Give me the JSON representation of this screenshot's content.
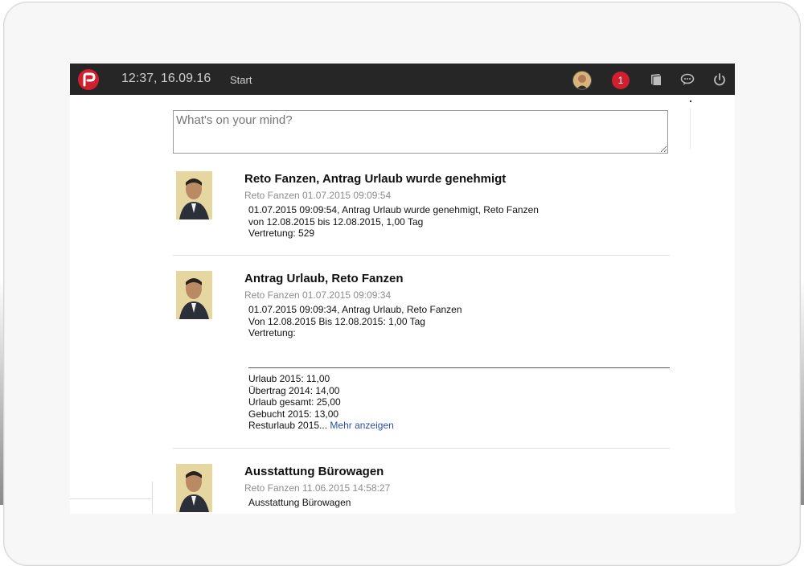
{
  "topbar": {
    "clock": "12:37, 16.09.16",
    "start_label": "Start",
    "notification_count": "1",
    "icons": [
      "logo-icon",
      "user-avatar",
      "notification-badge",
      "book-icon",
      "chat-icon",
      "power-icon"
    ],
    "colors": {
      "bar": "#262626",
      "accent": "#d01f2f"
    }
  },
  "composer": {
    "placeholder": "What's on your mind?"
  },
  "posts": [
    {
      "title": "Reto Fanzen, Antrag Urlaub wurde genehmigt",
      "meta": "Reto Fanzen 01.07.2015 09:09:54",
      "lines": [
        "01.07.2015 09:09:54, Antrag Urlaub wurde genehmigt, Reto Fanzen",
        "von 12.08.2015 bis 12.08.2015, 1,00 Tag",
        "Vertretung: 529"
      ]
    },
    {
      "title": "Antrag Urlaub, Reto Fanzen",
      "meta": "Reto Fanzen 01.07.2015 09:09:34",
      "lines": [
        "01.07.2015 09:09:34, Antrag Urlaub, Reto Fanzen",
        "Von 12.08.2015 Bis 12.08.2015: 1,00 Tag",
        "Vertretung:"
      ],
      "stats": [
        "Urlaub 2015: 11,00",
        "Übertrag 2014: 14,00",
        "Urlaub gesamt: 25,00",
        "Gebucht 2015: 13,00",
        "Resturlaub 2015..."
      ],
      "more_link": "Mehr anzeigen"
    },
    {
      "title": "Ausstattung Bürowagen",
      "meta": "Reto Fanzen 11.06.2015 14:58:27",
      "lines": [
        "Ausstattung Bürowagen"
      ]
    }
  ]
}
